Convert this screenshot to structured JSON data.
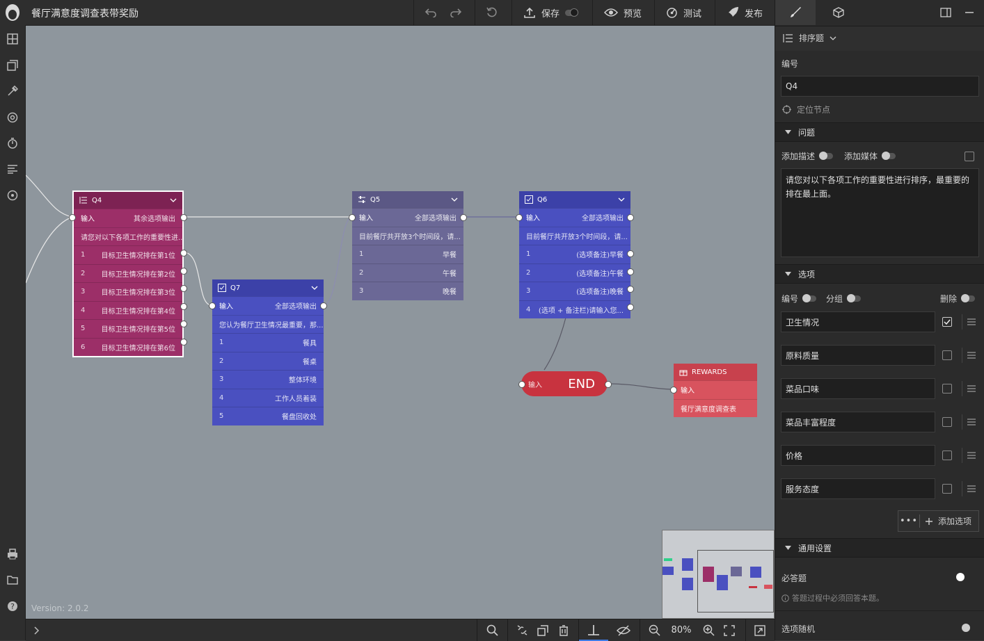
{
  "app": {
    "title": "餐厅满意度调查表带奖励",
    "version": "Version: 2.0.2"
  },
  "toolbar": {
    "save": "保存",
    "preview": "预览",
    "test": "测试",
    "publish": "发布"
  },
  "colors": {
    "q4": "#9c2f68",
    "q5": "#6b6896",
    "q7": "#4a50c0",
    "q6": "#4a50c0",
    "end": "#c8333f",
    "rewards": "#d8535e",
    "accent": "#3e7be6"
  },
  "nodes": {
    "q4": {
      "title": "Q4",
      "in": "输入",
      "out": "其余选项输出",
      "desc": "请您对以下各项工作的重要性进...",
      "rows": [
        {
          "n": "1",
          "t": "目标卫生情况排在第1位"
        },
        {
          "n": "2",
          "t": "目标卫生情况排在第2位"
        },
        {
          "n": "3",
          "t": "目标卫生情况排在第3位"
        },
        {
          "n": "4",
          "t": "目标卫生情况排在第4位"
        },
        {
          "n": "5",
          "t": "目标卫生情况排在第5位"
        },
        {
          "n": "6",
          "t": "目标卫生情况排在第6位"
        }
      ]
    },
    "q5": {
      "title": "Q5",
      "in": "输入",
      "out": "全部选项输出",
      "desc": "目前餐厅共开放3个时间段，请...",
      "rows": [
        {
          "n": "1",
          "t": "早餐"
        },
        {
          "n": "2",
          "t": "午餐"
        },
        {
          "n": "3",
          "t": "晚餐"
        }
      ]
    },
    "q7": {
      "title": "Q7",
      "in": "输入",
      "out": "全部选项输出",
      "desc": "您认为餐厅卫生情况最重要，那...",
      "rows": [
        {
          "n": "1",
          "t": "餐具"
        },
        {
          "n": "2",
          "t": "餐桌"
        },
        {
          "n": "3",
          "t": "整体环境"
        },
        {
          "n": "4",
          "t": "工作人员着装"
        },
        {
          "n": "5",
          "t": "餐盘回收处"
        }
      ]
    },
    "q6": {
      "title": "Q6",
      "in": "输入",
      "out": "全部选项输出",
      "desc": "目前餐厅共开放3个时间段，请...",
      "rows": [
        {
          "n": "1",
          "t": "(选项备注)早餐"
        },
        {
          "n": "2",
          "t": "(选项备注)午餐"
        },
        {
          "n": "3",
          "t": "(选项备注)晚餐"
        },
        {
          "n": "4",
          "t": "(选项 + 备注栏)请输入您..."
        }
      ]
    },
    "end": {
      "in": "输入",
      "label": "END"
    },
    "rewards": {
      "title": "REWARDS",
      "in": "输入",
      "desc": "餐厅满意度调查表"
    }
  },
  "panel": {
    "type_label": "排序题",
    "id_label": "编号",
    "id_value": "Q4",
    "locate": "定位节点",
    "question_section": "问题",
    "add_desc": "添加描述",
    "add_media": "添加媒体",
    "question_text": "请您对以下各项工作的重要性进行排序，最重要的排在最上面。",
    "options_section": "选项",
    "opt_number": "编号",
    "opt_group": "分组",
    "opt_delete": "删除",
    "options": [
      {
        "label": "卫生情况",
        "checked": true
      },
      {
        "label": "原料质量",
        "checked": false
      },
      {
        "label": "菜品口味",
        "checked": false
      },
      {
        "label": "菜品丰富程度",
        "checked": false
      },
      {
        "label": "价格",
        "checked": false
      },
      {
        "label": "服务态度",
        "checked": false
      }
    ],
    "add_option": "添加选项",
    "general_section": "通用设置",
    "required": "必答题",
    "required_hint": "答题过程中必须回答本题。",
    "random": "选项随机"
  },
  "bottom": {
    "zoom": "80%"
  }
}
